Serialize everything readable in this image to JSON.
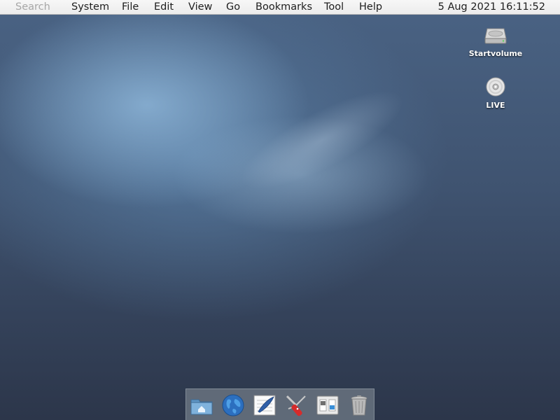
{
  "menubar": {
    "search_placeholder": "Search",
    "menus": [
      "System",
      "File",
      "Edit",
      "View",
      "Go",
      "Bookmarks",
      "Tool",
      "Help"
    ],
    "clock": "5 Aug 2021 16:11:52"
  },
  "desktop": {
    "icons": [
      {
        "label": "Startvolume",
        "icon": "hard-drive-icon"
      },
      {
        "label": "LIVE",
        "icon": "cd-disc-icon"
      }
    ]
  },
  "dock": {
    "items": [
      {
        "icon": "home-folder-icon"
      },
      {
        "icon": "globe-icon"
      },
      {
        "icon": "text-editor-icon"
      },
      {
        "icon": "swiss-army-knife-icon"
      },
      {
        "icon": "settings-panel-icon"
      },
      {
        "icon": "trash-icon"
      }
    ]
  },
  "colors": {
    "menubar_bg": "#efefef",
    "wallpaper_top": "#4a6384",
    "wallpaper_bottom": "#2c364a",
    "dock_bg": "#69737f"
  }
}
